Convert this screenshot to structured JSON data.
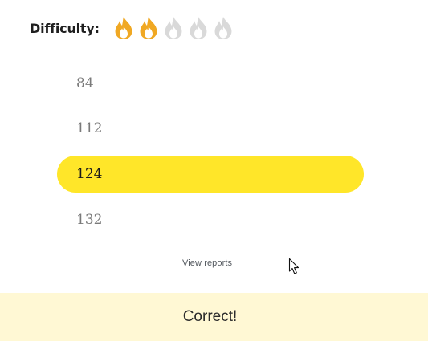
{
  "difficulty": {
    "label": "Difficulty:",
    "rating": 2,
    "max": 5,
    "icon": "flame-icon",
    "active_color": "#f0a823",
    "inactive_color": "#d9d9d9"
  },
  "options": [
    {
      "label": "84",
      "selected": false
    },
    {
      "label": "112",
      "selected": false
    },
    {
      "label": "124",
      "selected": true
    },
    {
      "label": "132",
      "selected": false
    }
  ],
  "highlight_color": "#ffe629",
  "view_reports_label": "View reports",
  "feedback": {
    "text": "Correct!",
    "background": "#fff8d4"
  }
}
